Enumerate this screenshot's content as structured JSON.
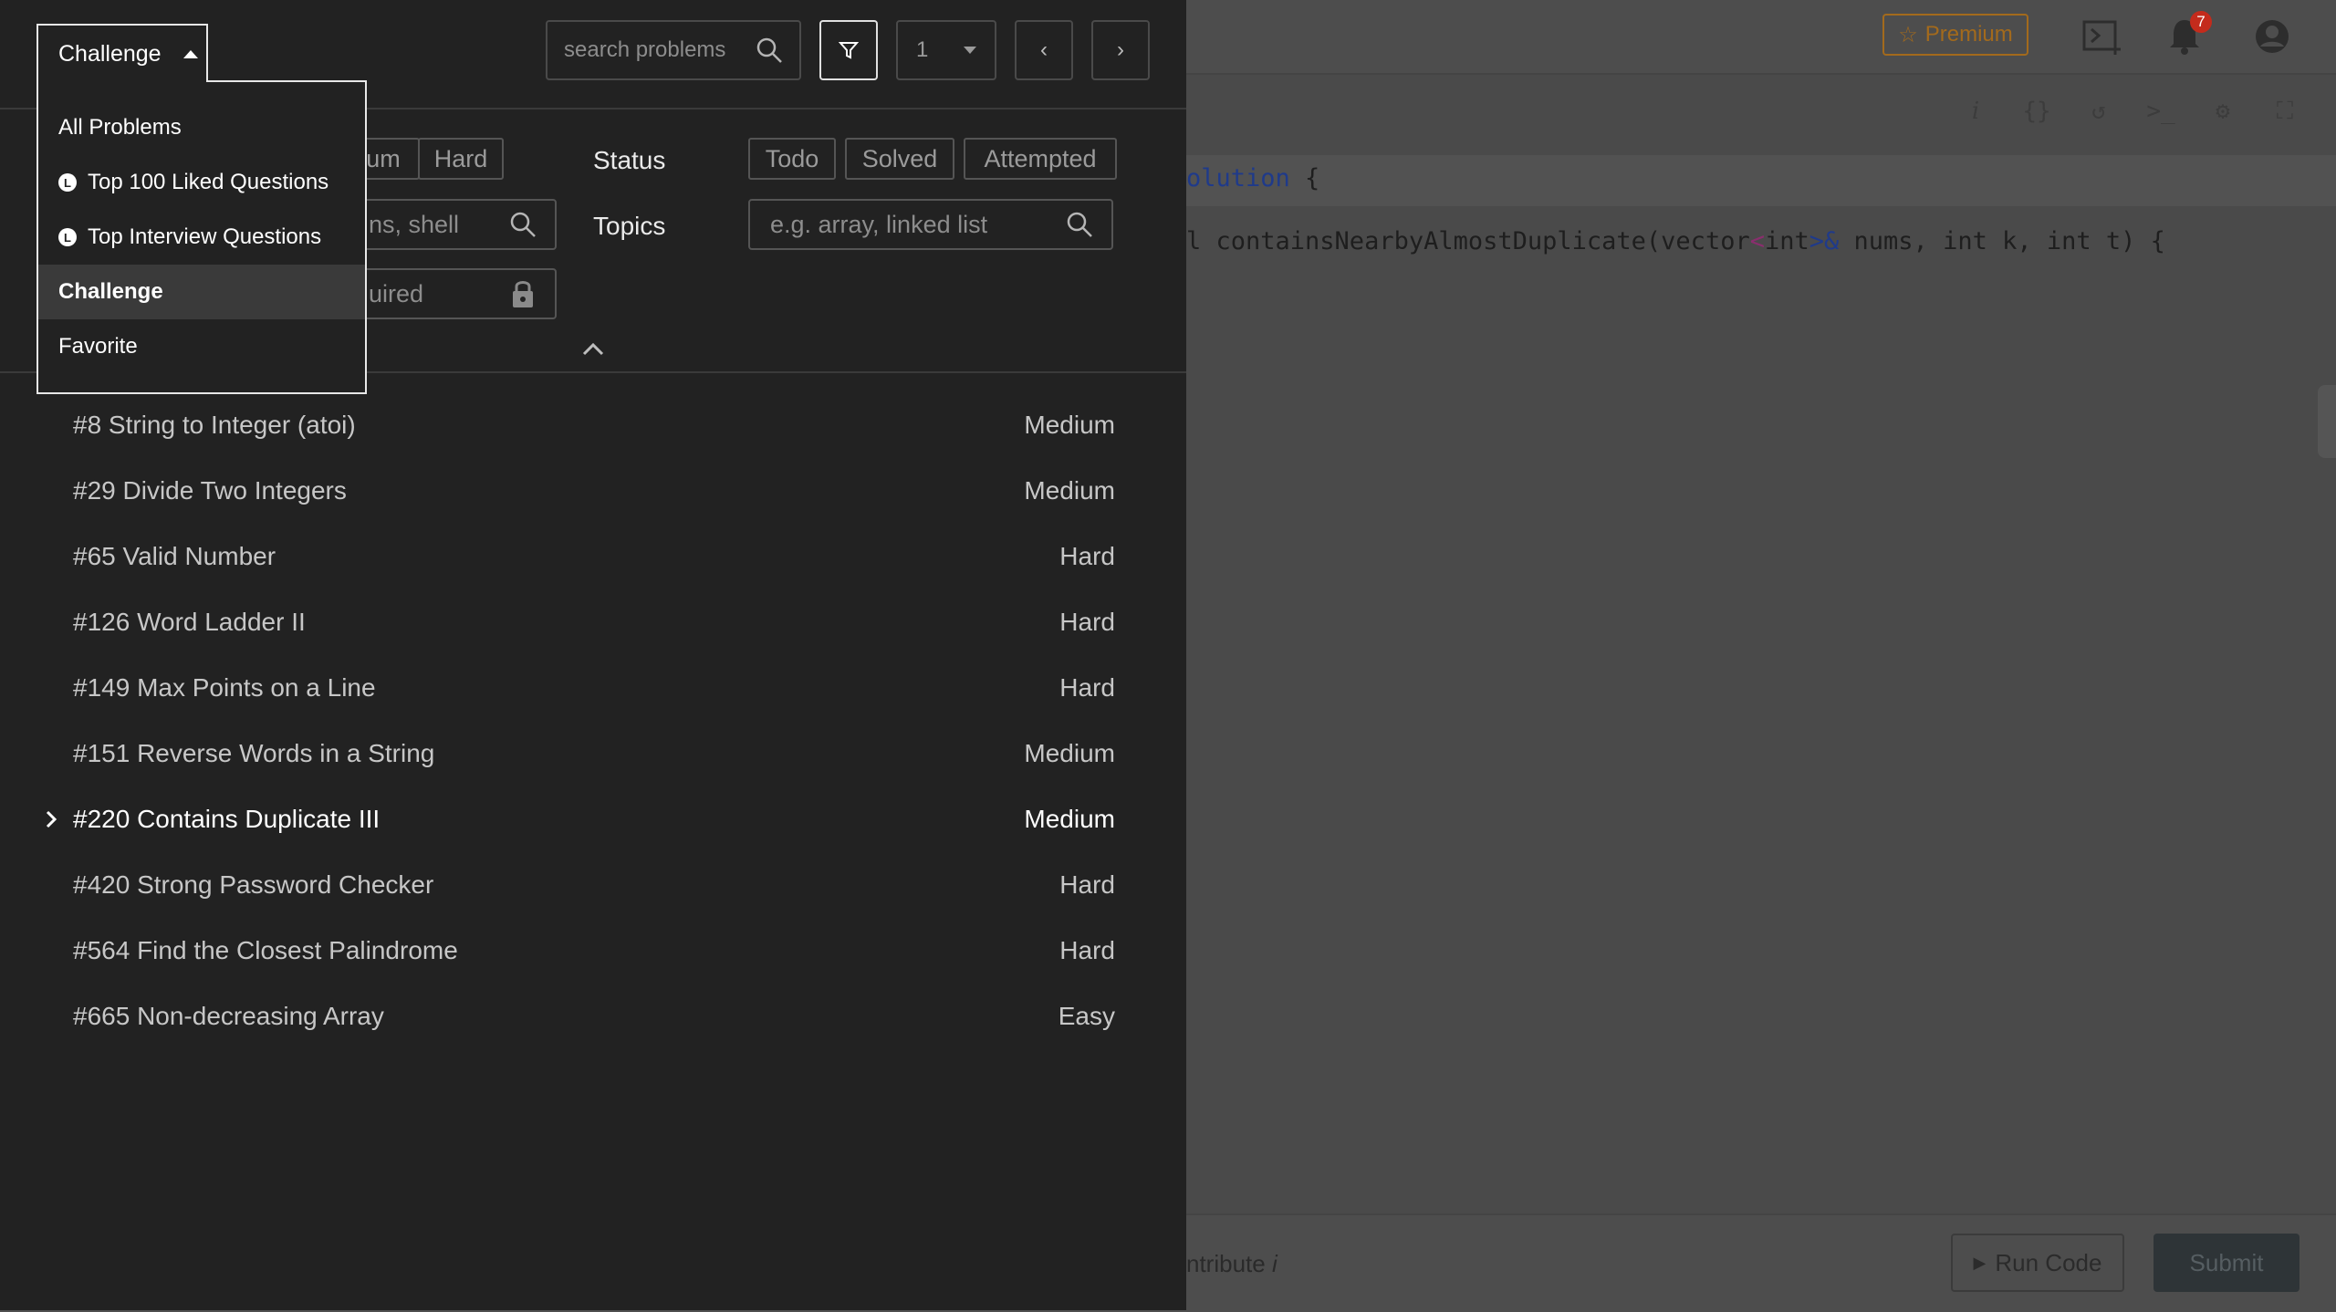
{
  "editor": {
    "premium_label": "Premium",
    "notification_count": "7",
    "code_line1_part1": "olution",
    "code_line1_part2": " {",
    "code_line2_part1": "l containsNearbyAlmostDuplicate(vector",
    "code_line2_lt": "<",
    "code_line2_int": "int",
    "code_line2_gt": ">&",
    "code_line2_part2": " nums, int k, int t) {",
    "contribute_label": "ntribute",
    "contribute_info": "i",
    "run_label": "Run Code",
    "submit_label": "Submit",
    "toolbar_icons": [
      "info-icon",
      "braces-icon",
      "reset-icon",
      "console-icon",
      "settings-icon",
      "fullscreen-icon"
    ]
  },
  "header": {
    "list_selector_label": "Challenge",
    "search_placeholder": "search problems",
    "page_number": "1"
  },
  "filters": {
    "difficulty_partial": [
      "um",
      "Hard"
    ],
    "status_label": "Status",
    "status_options": [
      "Todo",
      "Solved",
      "Attempted"
    ],
    "topics_label": "Topics",
    "topics_placeholder": "e.g. array, linked list",
    "tags_partial": "ns, shell",
    "companies_partial": "uired"
  },
  "dropdown": {
    "items": [
      {
        "label": "All Problems",
        "icon": ""
      },
      {
        "label": "Top 100 Liked Questions",
        "icon": "leetcode-icon"
      },
      {
        "label": "Top Interview Questions",
        "icon": "leetcode-icon"
      },
      {
        "label": "Challenge",
        "icon": "",
        "selected": true
      },
      {
        "label": "Favorite",
        "icon": ""
      }
    ]
  },
  "problems": [
    {
      "title": "#8 String to Integer (atoi)",
      "difficulty": "Medium"
    },
    {
      "title": "#29 Divide Two Integers",
      "difficulty": "Medium"
    },
    {
      "title": "#65 Valid Number",
      "difficulty": "Hard"
    },
    {
      "title": "#126 Word Ladder II",
      "difficulty": "Hard"
    },
    {
      "title": "#149 Max Points on a Line",
      "difficulty": "Hard"
    },
    {
      "title": "#151 Reverse Words in a String",
      "difficulty": "Medium"
    },
    {
      "title": "#220 Contains Duplicate III",
      "difficulty": "Medium",
      "active": true
    },
    {
      "title": "#420 Strong Password Checker",
      "difficulty": "Hard"
    },
    {
      "title": "#564 Find the Closest Palindrome",
      "difficulty": "Hard"
    },
    {
      "title": "#665 Non-decreasing Array",
      "difficulty": "Easy"
    }
  ]
}
